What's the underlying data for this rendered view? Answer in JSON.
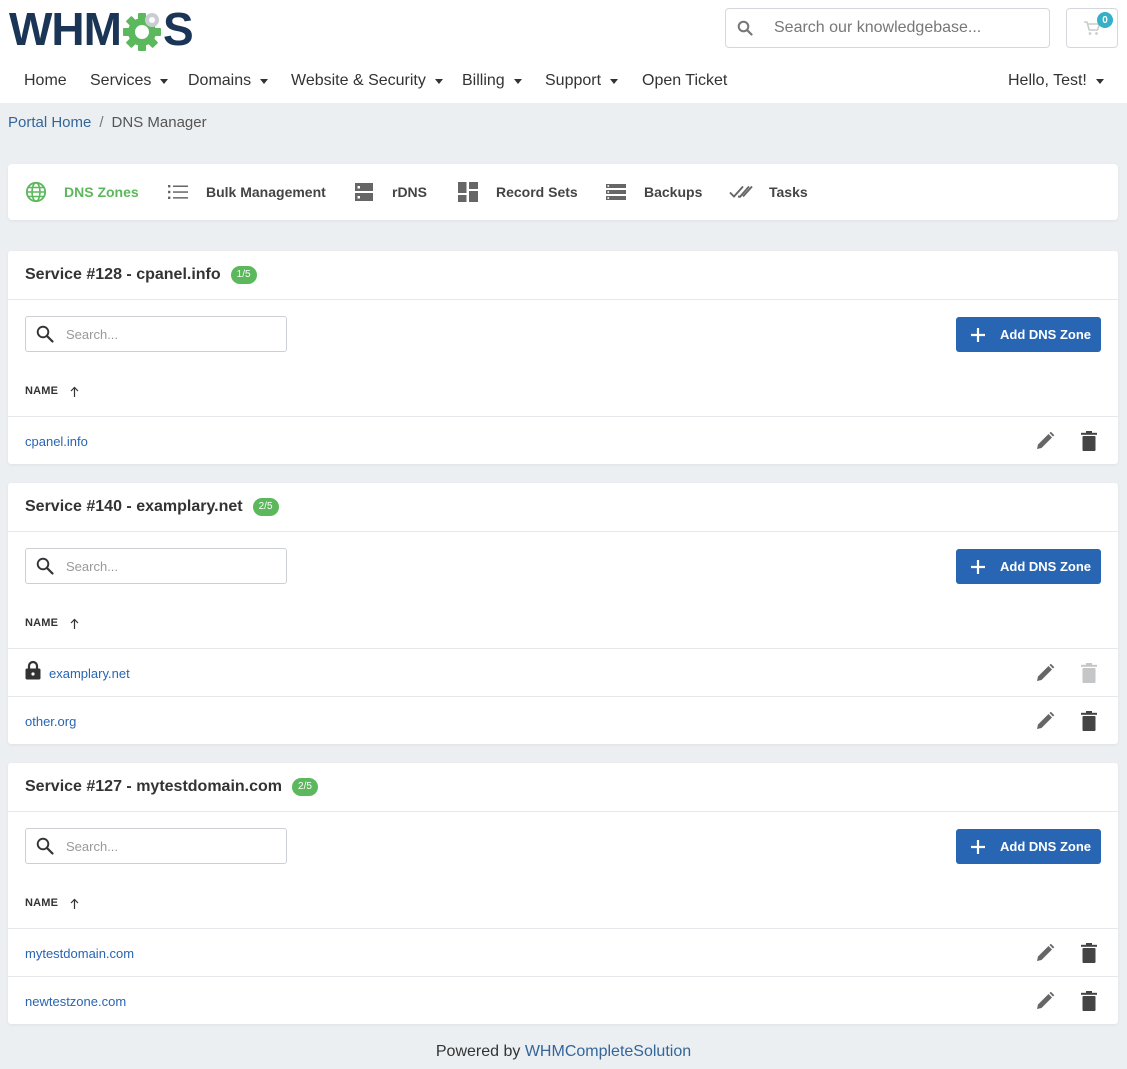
{
  "header": {
    "logo_text_left": "WHM",
    "logo_text_right": "S",
    "search_placeholder": "Search our knowledgebase...",
    "cart_count": "0"
  },
  "nav": {
    "items": [
      {
        "label": "Home",
        "has_caret": false
      },
      {
        "label": "Services",
        "has_caret": true
      },
      {
        "label": "Domains",
        "has_caret": true
      },
      {
        "label": "Website & Security",
        "has_caret": true
      },
      {
        "label": "Billing",
        "has_caret": true
      },
      {
        "label": "Support",
        "has_caret": true
      },
      {
        "label": "Open Ticket",
        "has_caret": false
      }
    ],
    "user": "Hello, Test!"
  },
  "breadcrumb": {
    "home": "Portal Home",
    "separator": "/",
    "current": "DNS Manager"
  },
  "tabs": [
    {
      "label": "DNS Zones",
      "icon": "globe-icon",
      "active": true
    },
    {
      "label": "Bulk Management",
      "icon": "list-icon",
      "active": false
    },
    {
      "label": "rDNS",
      "icon": "server-icon",
      "active": false
    },
    {
      "label": "Record Sets",
      "icon": "dashboard-icon",
      "active": false
    },
    {
      "label": "Backups",
      "icon": "storage-icon",
      "active": false
    },
    {
      "label": "Tasks",
      "icon": "double-check-icon",
      "active": false
    }
  ],
  "services": [
    {
      "title": "Service #128 - cpanel.info",
      "badge": "1/5",
      "search_placeholder": "Search...",
      "add_label": "Add DNS Zone",
      "column_name": "NAME",
      "zones": [
        {
          "name": "cpanel.info",
          "locked": false,
          "delete_enabled": true
        }
      ]
    },
    {
      "title": "Service #140 - examplary.net",
      "badge": "2/5",
      "search_placeholder": "Search...",
      "add_label": "Add DNS Zone",
      "column_name": "NAME",
      "zones": [
        {
          "name": "examplary.net",
          "locked": true,
          "delete_enabled": false
        },
        {
          "name": "other.org",
          "locked": false,
          "delete_enabled": true
        }
      ]
    },
    {
      "title": "Service #127 - mytestdomain.com",
      "badge": "2/5",
      "search_placeholder": "Search...",
      "add_label": "Add DNS Zone",
      "column_name": "NAME",
      "zones": [
        {
          "name": "mytestdomain.com",
          "locked": false,
          "delete_enabled": true
        },
        {
          "name": "newtestzone.com",
          "locked": false,
          "delete_enabled": true
        }
      ]
    }
  ],
  "footer": {
    "prefix": "Powered by",
    "link": "WHMCompleteSolution"
  },
  "colors": {
    "accent_green": "#5cb85c",
    "primary_blue": "#2865b2",
    "link_blue": "#336699",
    "logo_navy": "#1a3555",
    "badge_teal": "#35b0c6"
  }
}
